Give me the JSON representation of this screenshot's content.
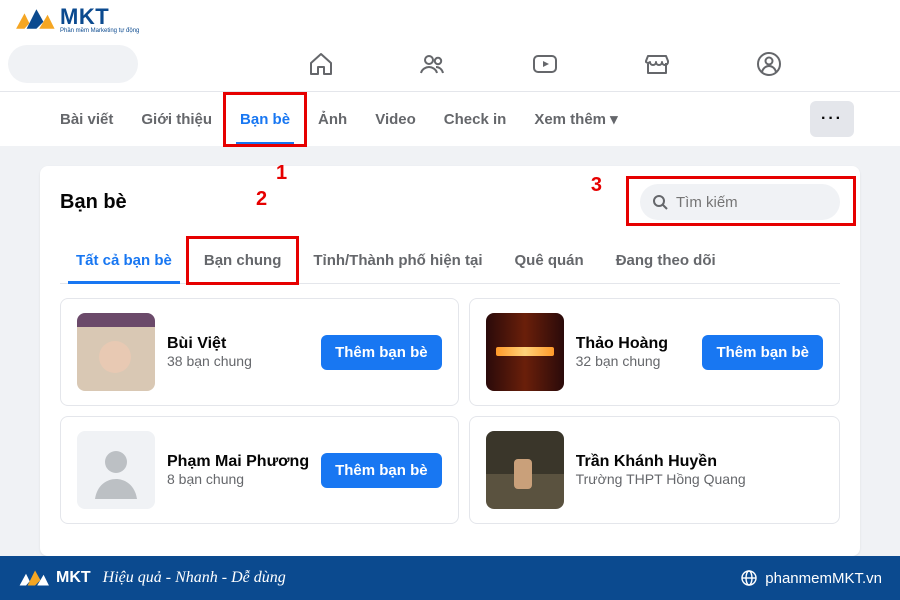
{
  "brand": {
    "name": "MKT",
    "sub": "Phần mềm Marketing tự động",
    "colors": {
      "blue": "#0b4a8f",
      "orange": "#f5a623",
      "red": "#e60000",
      "fbblue": "#1877f2"
    }
  },
  "profile_tabs": [
    {
      "label": "Bài viết"
    },
    {
      "label": "Giới thiệu"
    },
    {
      "label": "Bạn bè",
      "active": true,
      "callout": "1"
    },
    {
      "label": "Ảnh"
    },
    {
      "label": "Video"
    },
    {
      "label": "Check in"
    },
    {
      "label": "Xem thêm ▾"
    }
  ],
  "more_button": "···",
  "friends_section": {
    "title": "Bạn bè",
    "search_placeholder": "Tìm kiếm",
    "callout_search": "3",
    "subtabs": [
      {
        "label": "Tất cả bạn bè",
        "active": true
      },
      {
        "label": "Bạn chung",
        "callout": "2"
      },
      {
        "label": "Tỉnh/Thành phố hiện tại"
      },
      {
        "label": "Quê quán"
      },
      {
        "label": "Đang theo dõi"
      }
    ],
    "friends": [
      {
        "name": "Bùi Việt",
        "sub": "38 bạn chung",
        "action": "Thêm bạn bè",
        "avatar_class": "user1"
      },
      {
        "name": "Thảo Hoàng",
        "sub": "32 bạn chung",
        "action": "Thêm bạn bè",
        "avatar_class": "user2"
      },
      {
        "name": "Phạm Mai Phương",
        "sub": "8 bạn chung",
        "action": "Thêm bạn bè",
        "avatar_class": "user3"
      },
      {
        "name": "Trần Khánh Huyền",
        "sub": "Trường THPT Hồng Quang",
        "action": null,
        "avatar_class": "user4"
      }
    ]
  },
  "bottom": {
    "tagline": "Hiệu quả - Nhanh  - Dễ dùng",
    "url": "phanmemMKT.vn"
  }
}
